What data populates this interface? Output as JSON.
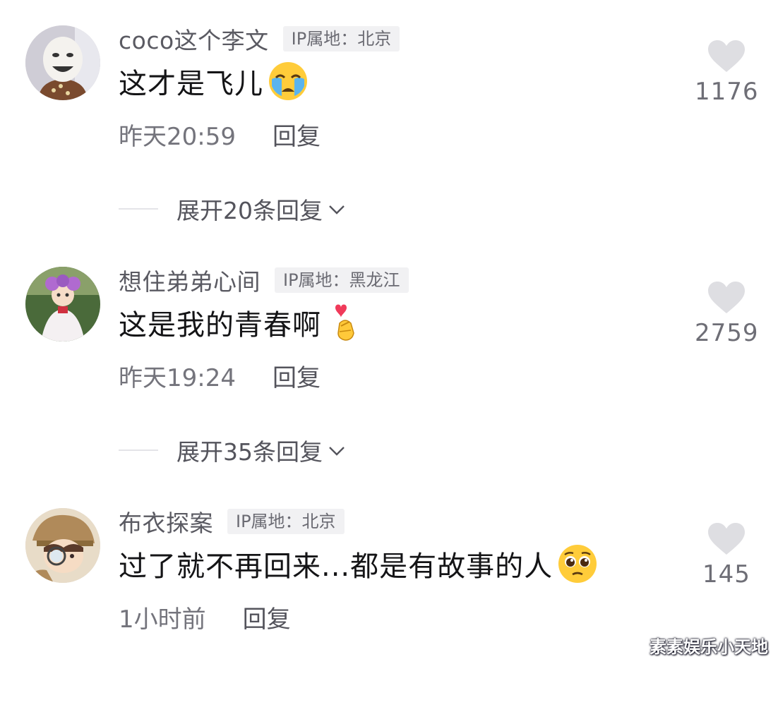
{
  "comments": [
    {
      "username": "coco这个李文",
      "ip_label": "IP属地：北京",
      "text": "这才是飞儿",
      "emoji": "crying-face-emoji",
      "time": "昨天20:59",
      "reply_label": "回复",
      "expand_label": "展开20条回复",
      "likes": "1176"
    },
    {
      "username": "想住弟弟心间",
      "ip_label": "IP属地：黑龙江",
      "text": "这是我的青春啊",
      "emoji": "finger-heart-emoji",
      "time": "昨天19:24",
      "reply_label": "回复",
      "expand_label": "展开35条回复",
      "likes": "2759"
    },
    {
      "username": "布衣探案",
      "ip_label": "IP属地：北京",
      "text": "过了就不再回来...都是有故事的人",
      "emoji": "pleading-face-emoji",
      "time": "1小时前",
      "reply_label": "回复",
      "likes": "145"
    }
  ],
  "icons": {
    "like": "heart-icon",
    "expand": "chevron-down-icon"
  },
  "colors": {
    "heart": "#dedee2",
    "text_primary": "#141416",
    "text_secondary": "#74747c",
    "badge_bg": "#f1f1f3"
  },
  "watermark": "素素娱乐小天地"
}
